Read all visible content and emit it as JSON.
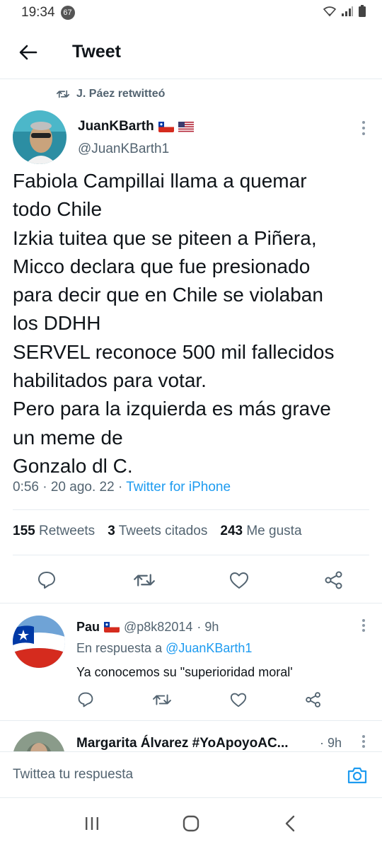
{
  "status_bar": {
    "time": "19:34",
    "notification_count": "67"
  },
  "header": {
    "title": "Tweet"
  },
  "retweet": {
    "text": "J. Páez retwitteó"
  },
  "tweet": {
    "author_name": "JuanKBarth",
    "author_handle": "@JuanKBarth1",
    "text": "Fabiola Campillai llama a quemar\ntodo Chile\nIzkia tuitea que se piteen a Piñera,\nMicco declara que fue presionado\npara decir que en Chile se violaban\nlos DDHH\nSERVEL reconoce 500 mil fallecidos\nhabilitados para votar.\nPero para la izquierda es más grave\nun meme de\nGonzalo dl C.",
    "time_date": "0:56 · 20 ago. 22 · ",
    "source": "Twitter for iPhone",
    "stats": {
      "retweets_count": "155",
      "retweets_label": "Retweets",
      "quotes_count": "3",
      "quotes_label": "Tweets citados",
      "likes_count": "243",
      "likes_label": "Me gusta"
    }
  },
  "replies": [
    {
      "name": "Pau",
      "handle": "@p8k82014",
      "time": "· 9h",
      "in_reply_prefix": "En respuesta a ",
      "in_reply_mention": "@JuanKBarth1",
      "text": "Ya conocemos su \"superioridad moral'"
    },
    {
      "name": "Margarita Álvarez #YoApoyoAC...",
      "time": "· 9h"
    }
  ],
  "compose": {
    "placeholder": "Twittea tu respuesta"
  },
  "colors": {
    "accent": "#1d9bf0",
    "secondary_text": "#536471",
    "divider": "#e6ecf0"
  }
}
